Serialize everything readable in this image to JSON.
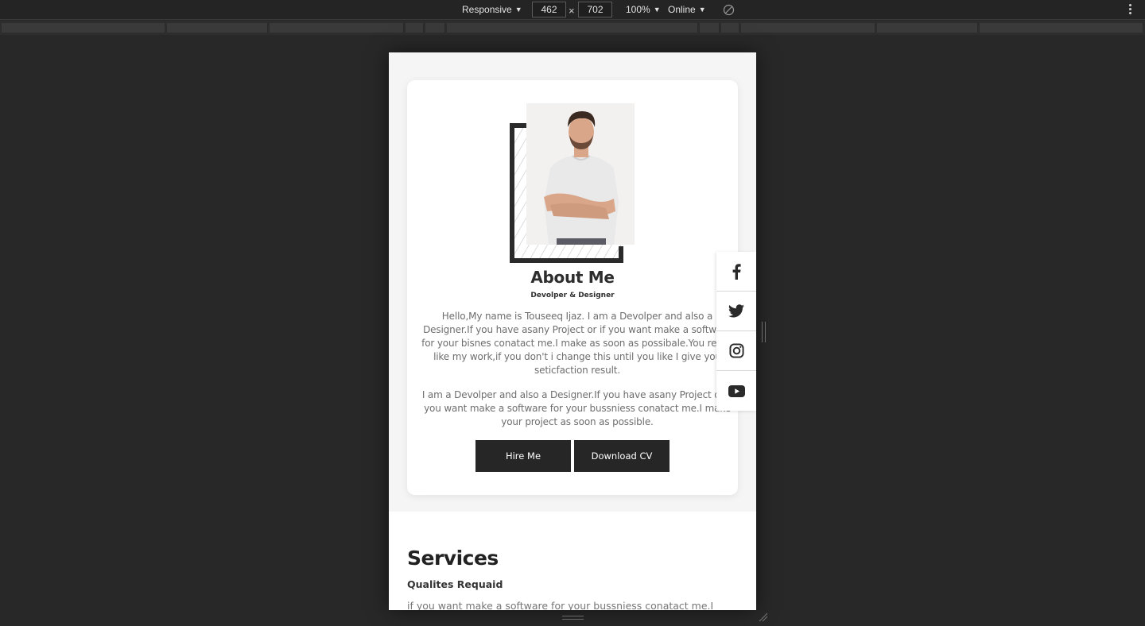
{
  "devtools": {
    "device_mode": "Responsive",
    "width": "462",
    "height": "702",
    "times": "×",
    "zoom": "100%",
    "network": "Online",
    "icons": [
      "rotate-icon",
      "more-options-icon",
      "caret-down-icon"
    ]
  },
  "about": {
    "title": "About Me",
    "subtitle": "Devolper & Designer",
    "paragraph1": "Hello,My name is Touseeq Ijaz. I am a Devolper and also a Designer.If you have asany Project or if you want make a software for your bisnes conatact me.I make as soon as possibale.You really like my work,if you don't i change this until you like I give you seticfaction result.",
    "paragraph2": "I am a Devolper and also a Designer.If you have asany Project or if you want make a software for your bussniess conatact me.I make your project as soon as possible.",
    "hire_label": "Hire Me",
    "cv_label": "Download CV"
  },
  "social": {
    "items": [
      "facebook-icon",
      "twitter-icon",
      "instagram-icon",
      "youtube-icon"
    ]
  },
  "services": {
    "title": "Services",
    "subtitle": "Qualites Requaid",
    "text": "if you want make a software for your bussniess conatact me.I"
  },
  "colors": {
    "page_bg": "#282828",
    "viewport_bg": "#f5f5f5",
    "button_bg": "#262626",
    "accent_dark": "#2a2a2a"
  }
}
